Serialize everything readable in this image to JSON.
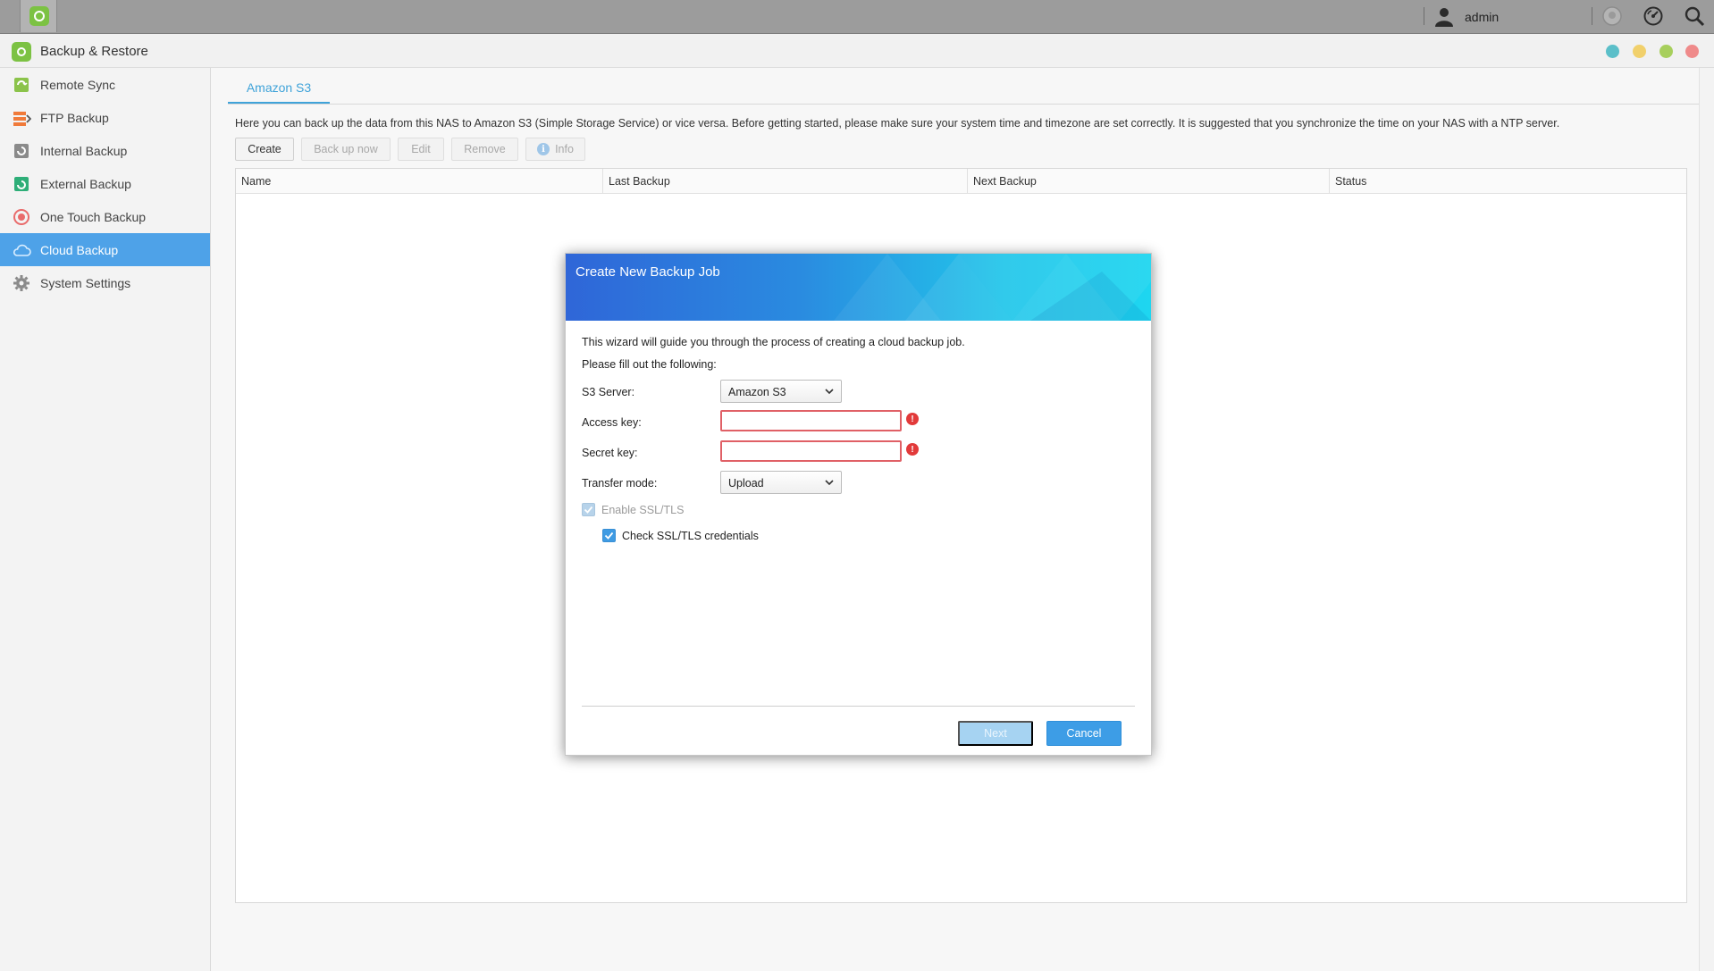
{
  "topbar": {
    "user": "admin"
  },
  "window": {
    "title": "Backup & Restore"
  },
  "sidebar": {
    "items": [
      {
        "label": "Remote Sync",
        "icon": "remote-sync-icon"
      },
      {
        "label": "FTP Backup",
        "icon": "ftp-backup-icon"
      },
      {
        "label": "Internal Backup",
        "icon": "internal-backup-icon"
      },
      {
        "label": "External Backup",
        "icon": "external-backup-icon"
      },
      {
        "label": "One Touch Backup",
        "icon": "one-touch-backup-icon"
      },
      {
        "label": "Cloud Backup",
        "icon": "cloud-icon",
        "active": true
      },
      {
        "label": "System Settings",
        "icon": "gear-icon"
      }
    ]
  },
  "main": {
    "tab": "Amazon S3",
    "description": "Here you can back up the data from this NAS to Amazon S3 (Simple Storage Service) or vice versa. Before getting started, please make sure your system time and timezone are set correctly. It is suggested that you synchronize the time on your NAS with a NTP server.",
    "toolbar": {
      "create": "Create",
      "backup_now": "Back up now",
      "edit": "Edit",
      "remove": "Remove",
      "info": "Info"
    },
    "columns": [
      "Name",
      "Last Backup",
      "Next Backup",
      "Status"
    ]
  },
  "dialog": {
    "title": "Create New Backup Job",
    "intro": "This wizard will guide you through the process of creating a cloud backup job.",
    "prompt": "Please fill out the following:",
    "s3_server_label": "S3 Server:",
    "s3_server_value": "Amazon S3",
    "access_key_label": "Access key:",
    "access_key_value": "",
    "secret_key_label": "Secret key:",
    "secret_key_value": "",
    "transfer_mode_label": "Transfer mode:",
    "transfer_mode_value": "Upload",
    "enable_ssl_label": "Enable SSL/TLS",
    "check_ssl_label": "Check SSL/TLS credentials",
    "next": "Next",
    "cancel": "Cancel"
  },
  "colors": {
    "accent": "#4ea2e8",
    "brand_green": "#7cc243",
    "error": "#e23a3a",
    "dot_teal": "#5bbfc9",
    "dot_yellow": "#f1d06b",
    "dot_green": "#a7cf5c",
    "dot_red": "#ef8a8a"
  }
}
